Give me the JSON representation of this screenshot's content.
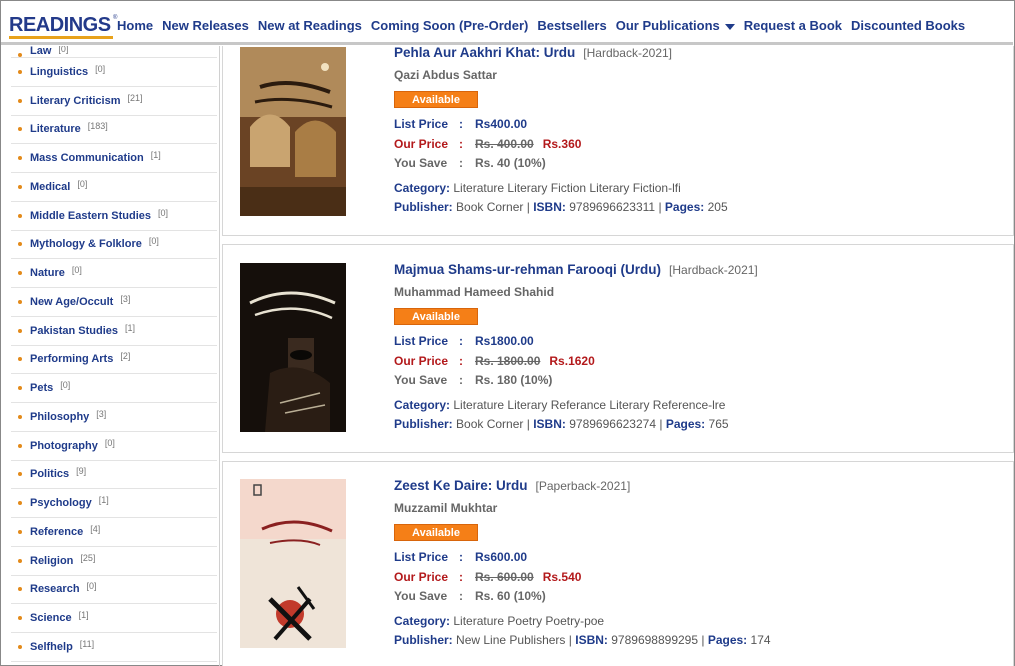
{
  "logo": {
    "text": "READINGS",
    "tm": "®"
  },
  "nav": [
    {
      "label": "Home"
    },
    {
      "label": "New Releases"
    },
    {
      "label": "New at Readings"
    },
    {
      "label": "Coming Soon (Pre-Order)"
    },
    {
      "label": "Bestsellers"
    },
    {
      "label": "Our Publications",
      "has_caret": true
    },
    {
      "label": "Request a Book"
    },
    {
      "label": "Discounted Books"
    }
  ],
  "sidebar": {
    "items": [
      {
        "label": "Law",
        "count": "[0]"
      },
      {
        "label": "Linguistics",
        "count": "[0]"
      },
      {
        "label": "Literary Criticism",
        "count": "[21]"
      },
      {
        "label": "Literature",
        "count": "[183]"
      },
      {
        "label": "Mass Communication",
        "count": "[1]"
      },
      {
        "label": "Medical",
        "count": "[0]"
      },
      {
        "label": "Middle Eastern Studies",
        "count": "[0]"
      },
      {
        "label": "Mythology & Folklore",
        "count": "[0]"
      },
      {
        "label": "Nature",
        "count": "[0]"
      },
      {
        "label": "New Age/Occult",
        "count": "[3]"
      },
      {
        "label": "Pakistan Studies",
        "count": "[1]"
      },
      {
        "label": "Performing Arts",
        "count": "[2]"
      },
      {
        "label": "Pets",
        "count": "[0]"
      },
      {
        "label": "Philosophy",
        "count": "[3]"
      },
      {
        "label": "Photography",
        "count": "[0]"
      },
      {
        "label": "Politics",
        "count": "[9]"
      },
      {
        "label": "Psychology",
        "count": "[1]"
      },
      {
        "label": "Reference",
        "count": "[4]"
      },
      {
        "label": "Religion",
        "count": "[25]"
      },
      {
        "label": "Research",
        "count": "[0]"
      },
      {
        "label": "Science",
        "count": "[1]"
      },
      {
        "label": "Selfhelp",
        "count": "[11]"
      }
    ]
  },
  "labels": {
    "available": "Available",
    "list_price": "List Price",
    "our_price": "Our Price",
    "you_save": "You Save",
    "colon": ":",
    "category": "Category:",
    "publisher": "Publisher:",
    "isbn": "ISBN:",
    "pages": "Pages:",
    "sep": "|"
  },
  "products": [
    {
      "title": "Pehla Aur Aakhri Khat: Urdu",
      "format": "[Hardback-2021]",
      "author": "Qazi Abdus Sattar",
      "list_price": "Rs400.00",
      "old_price": "Rs. 400.00",
      "our_price": "Rs.360",
      "you_save": "Rs. 40 (10%)",
      "category": "Literature Literary Fiction Literary Fiction-lfi",
      "publisher": "Book Corner",
      "isbn": "9789696623311",
      "pages": "205",
      "cover_color": "#8a5a2b"
    },
    {
      "title": "Majmua Shams-ur-rehman Farooqi (Urdu)",
      "format": "[Hardback-2021]",
      "author": "Muhammad Hameed Shahid",
      "list_price": "Rs1800.00",
      "old_price": "Rs. 1800.00",
      "our_price": "Rs.1620",
      "you_save": "Rs. 180 (10%)",
      "category": "Literature Literary Referance Literary Reference-lre",
      "publisher": "Book Corner",
      "isbn": "9789696623274",
      "pages": "765",
      "cover_color": "#1a1410"
    },
    {
      "title": "Zeest Ke Daire: Urdu",
      "format": "[Paperback-2021]",
      "author": "Muzzamil Mukhtar",
      "list_price": "Rs600.00",
      "old_price": "Rs. 600.00",
      "our_price": "Rs.540",
      "you_save": "Rs. 60 (10%)",
      "category": "Literature Poetry Poetry-poe",
      "publisher": "New Line Publishers",
      "isbn": "9789698899295",
      "pages": "174",
      "cover_color": "#e9ddd0"
    }
  ]
}
